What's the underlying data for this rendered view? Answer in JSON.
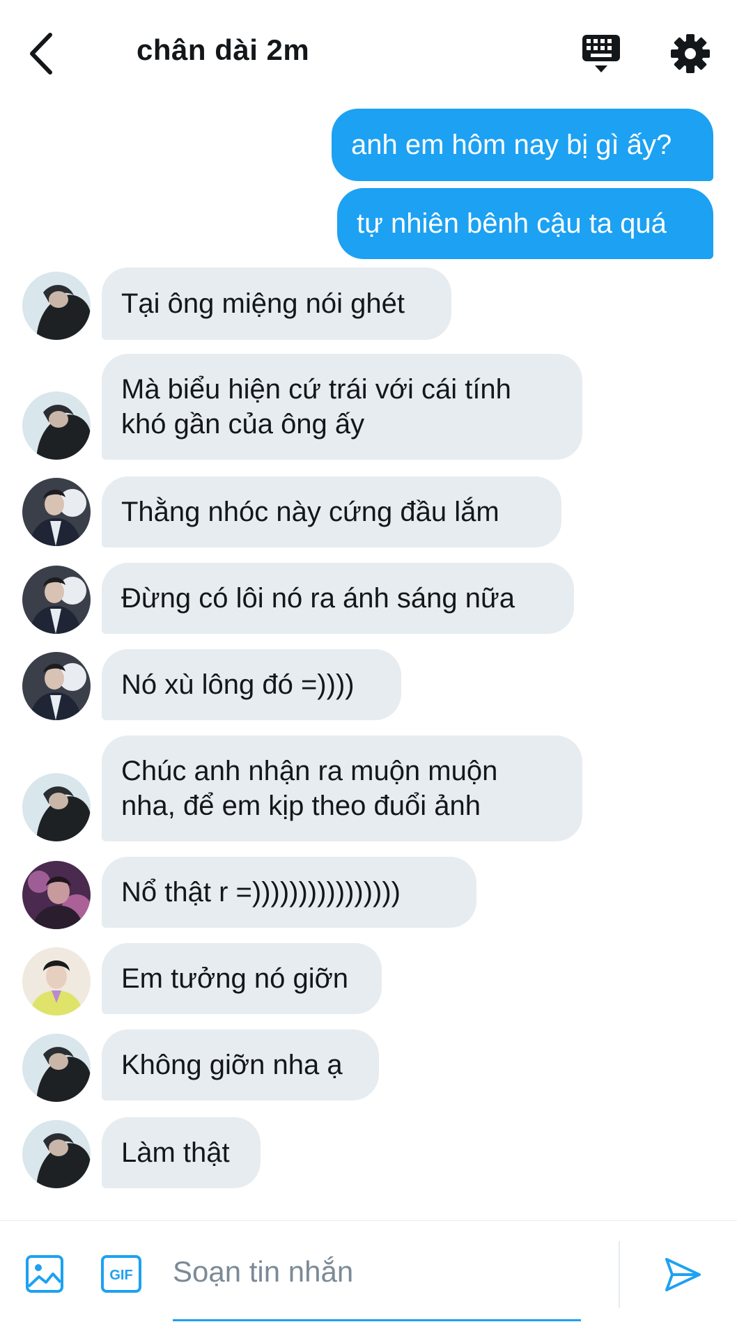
{
  "header": {
    "back_icon": "chevron-left-icon",
    "title": "chân dài 2m",
    "keyboard_icon": "keyboard-icon",
    "settings_icon": "gear-icon"
  },
  "messages": [
    {
      "side": "sent",
      "lines": [
        "anh em hôm nay bị gì ấy?"
      ]
    },
    {
      "side": "sent",
      "lines": [
        "tự nhiên bênh cậu ta quá"
      ]
    },
    {
      "side": "received",
      "avatar": "avatar-a",
      "lines": [
        "Tại ông miệng nói ghét"
      ]
    },
    {
      "side": "received",
      "avatar": "avatar-a",
      "lines": [
        "Mà biểu hiện cứ trái với cái tính",
        "khó gần của ông ấy"
      ]
    },
    {
      "side": "received",
      "avatar": "avatar-b",
      "lines": [
        "Thằng nhóc này cứng đầu lắm"
      ]
    },
    {
      "side": "received",
      "avatar": "avatar-b",
      "lines": [
        "Đừng có lôi nó ra ánh sáng nữa"
      ]
    },
    {
      "side": "received",
      "avatar": "avatar-b",
      "lines": [
        "Nó xù lông đó =))))"
      ]
    },
    {
      "side": "received",
      "avatar": "avatar-a",
      "lines": [
        "Chúc anh nhận ra muộn muộn",
        "nha, để em kịp theo đuổi ảnh"
      ]
    },
    {
      "side": "received",
      "avatar": "avatar-c",
      "lines": [
        "Nổ thật r =))))))))))))))))"
      ]
    },
    {
      "side": "received",
      "avatar": "avatar-d",
      "lines": [
        "Em tưởng nó giỡn"
      ]
    },
    {
      "side": "received",
      "avatar": "avatar-a",
      "lines": [
        "Không giỡn nha ạ"
      ]
    },
    {
      "side": "received",
      "avatar": "avatar-a",
      "lines": [
        "Làm thật"
      ]
    }
  ],
  "composer": {
    "image_icon": "image-icon",
    "gif_label": "GIF",
    "placeholder": "Soạn tin nhắn",
    "value": "",
    "send_icon": "send-icon"
  },
  "colors": {
    "accent": "#1da1f2",
    "received_bubble": "#e6ecf0",
    "text": "#14171a",
    "placeholder": "#7b8a96"
  }
}
